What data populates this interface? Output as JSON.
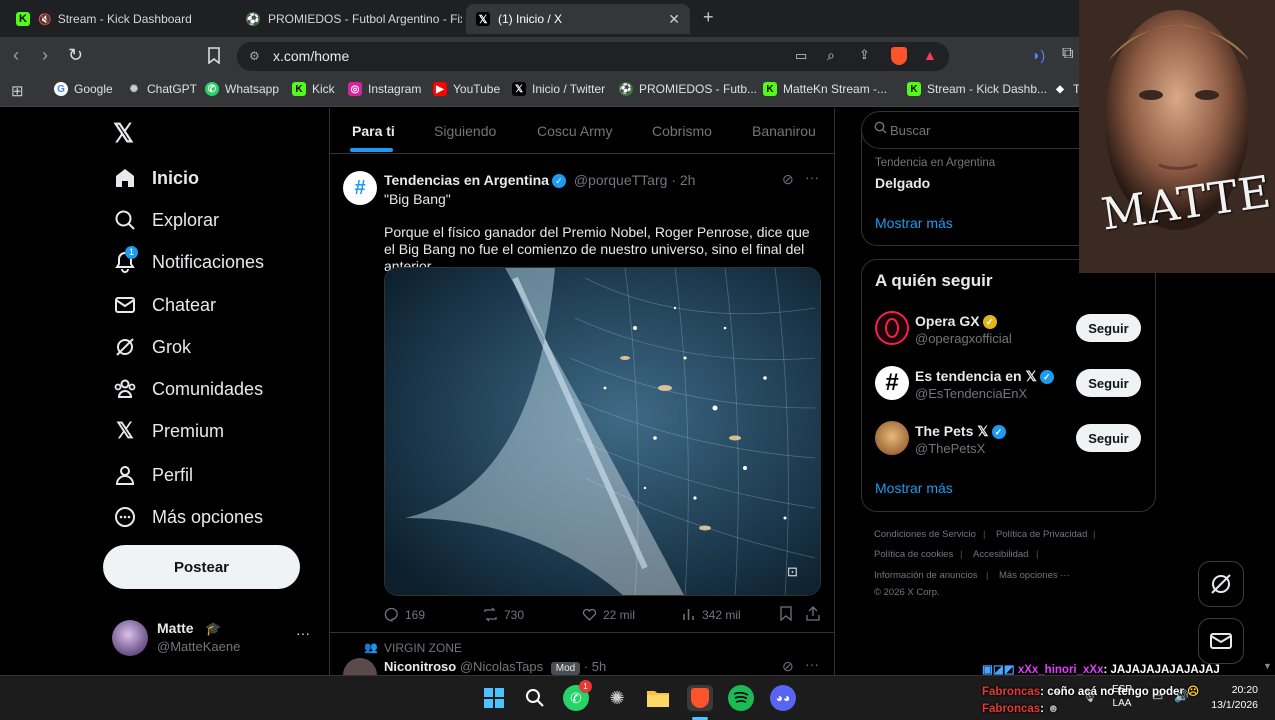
{
  "browser": {
    "tabs": [
      {
        "title": "Stream - Kick Dashboard",
        "icon": "kick-icon"
      },
      {
        "title": "PROMIEDOS - Futbol Argentino - Fixt",
        "icon": "promiedos-icon"
      },
      {
        "title": "(1) Inicio / X",
        "icon": "x-icon",
        "active": true
      }
    ],
    "new_tab": "+",
    "url": "x.com/home",
    "bookmarks": [
      "Google",
      "ChatGPT",
      "Whatsapp",
      "Kick",
      "Instagram",
      "YouTube",
      "Inicio / Twitter",
      "PROMIEDOS - Futb...",
      "MatteKn Stream -...",
      "Stream - Kick Dashb...",
      "T"
    ]
  },
  "sidebar": {
    "items": [
      {
        "label": "Inicio",
        "icon": "home-icon"
      },
      {
        "label": "Explorar",
        "icon": "search-icon"
      },
      {
        "label": "Notificaciones",
        "icon": "bell-icon",
        "badge": "1"
      },
      {
        "label": "Chatear",
        "icon": "mail-icon"
      },
      {
        "label": "Grok",
        "icon": "grok-icon"
      },
      {
        "label": "Comunidades",
        "icon": "communities-icon"
      },
      {
        "label": "Premium",
        "icon": "x-premium-icon"
      },
      {
        "label": "Perfil",
        "icon": "person-icon"
      },
      {
        "label": "Más opciones",
        "icon": "more-circle-icon"
      }
    ],
    "post_button": "Postear",
    "account": {
      "name": "Matte",
      "handle": "@MatteKaene",
      "more": "···"
    }
  },
  "feed": {
    "tabs": [
      "Para ti",
      "Siguiendo",
      "Coscu Army",
      "Cobrismo",
      "Bananirou"
    ],
    "post": {
      "author": "Tendencias en Argentina",
      "handle": "@porqueTTarg",
      "time": "· 2h",
      "title": "\"Big Bang\"",
      "text": "Porque el físico ganador del Premio Nobel, Roger Penrose, dice que el Big Bang no fue el comienzo de nuestro universo, sino el final del anterior.",
      "replies": "169",
      "reposts": "730",
      "likes": "22 mil",
      "views": "342 mil"
    },
    "next_post": {
      "community": "VIRGIN ZONE",
      "author": "Niconitroso",
      "handle": "@NicolasTaps",
      "badge": "Mod",
      "time": "· 5h"
    }
  },
  "right": {
    "search_placeholder": "Buscar",
    "trend": {
      "context": "Tendencia en Argentina",
      "name": "Delgado"
    },
    "show_more_1": "Mostrar más",
    "who_to_follow_title": "A quién seguir",
    "follow": [
      {
        "name": "Opera GX",
        "handle": "@operagxofficial",
        "button": "Seguir",
        "verified": "gold"
      },
      {
        "name": "Es tendencia en 𝕏",
        "handle": "@EsTendenciaEnX",
        "button": "Seguir",
        "verified": "blue"
      },
      {
        "name": "The Pets 𝕏",
        "handle": "@ThePetsX",
        "button": "Seguir",
        "verified": "blue"
      }
    ],
    "show_more_2": "Mostrar más",
    "footer": [
      "Condiciones de Servicio",
      "Política de Privacidad",
      "Política de cookies",
      "Accesibilidad",
      "Información de anuncios",
      "Más opciones ···",
      "© 2026 X Corp."
    ]
  },
  "overlay": {
    "webcam_text": "MATTE",
    "chat": [
      {
        "user": "xXx_hinori_xXx",
        "msg": ": JAJAJAJAJAJAJAJ",
        "color": "#e040fb"
      },
      {
        "user": "Fabroncas",
        "msg": ": coño acá no tengo poder",
        "color": "#e53935"
      },
      {
        "user": "Fabroncas",
        "msg": ":",
        "color": "#e53935"
      }
    ]
  },
  "taskbar": {
    "lang": "ESP",
    "lang2": "LAA",
    "time": "20:20",
    "date": "13/1/2026"
  },
  "colors": {
    "accent": "#1d9bf0",
    "bg": "#000000",
    "border": "#2f3336",
    "muted": "#71767b"
  }
}
